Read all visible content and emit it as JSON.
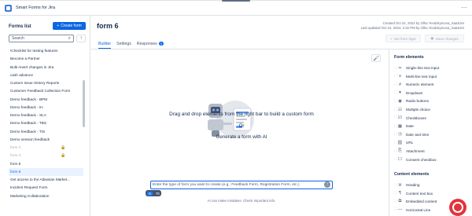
{
  "app": {
    "title": "Smart Forms for Jira"
  },
  "sidebar": {
    "title": "Forms list",
    "create_label": "Create form",
    "search_placeholder": "Search",
    "items": [
      {
        "label": "!Checklist for testing features"
      },
      {
        "label": "Become a Partner"
      },
      {
        "label": "Bulk revert changes in Jira"
      },
      {
        "label": "cash advance"
      },
      {
        "label": "Custom Issue History Reports"
      },
      {
        "label": "Customer Feedback Collection Form"
      },
      {
        "label": "Demo feedback - BPM"
      },
      {
        "label": "Demo feedback - IH"
      },
      {
        "label": "Demo feedback - SLA"
      },
      {
        "label": "Demo feedback - TBS"
      },
      {
        "label": "Demo feedback - TIS"
      },
      {
        "label": "Demo session feedback"
      },
      {
        "label": "form 3",
        "locked": true
      },
      {
        "label": "form 4",
        "locked": true
      },
      {
        "label": "form 5"
      },
      {
        "label": "form 6",
        "selected": true
      },
      {
        "label": "Get access to the Atlassian Market..."
      },
      {
        "label": "Incident Request Form"
      },
      {
        "label": "Marketing Collaboration"
      }
    ]
  },
  "form": {
    "title": "form 6",
    "created": "Created Oct 24, 2024 by Olha Yevdokymova_SaaSJet",
    "updated": "Last updated Oct 24, 2024, 2:32 PM by Olha Yevdokymova_SaaSJet",
    "set_logic_label": "Set form logic",
    "save_label": "Save changes"
  },
  "tabs": [
    {
      "label": "Builder",
      "active": true
    },
    {
      "label": "Settings"
    },
    {
      "label": "Responses",
      "badge": "0"
    }
  ],
  "builder": {
    "dropzone_text": "Drag and drop elements from the right bar to build a custom form",
    "or_text": "Or",
    "generate_text": "Generate a form with AI",
    "ai_placeholder": "Enter the type of form you want to create (e.g., Feedback Form, Registration Form, etc.)",
    "chip_a": "A",
    "chip_count": "78",
    "disclaimer": "AI can make mistakes. Check important info."
  },
  "elements_panel": {
    "form_elements_title": "Form elements",
    "form_elements": [
      {
        "label": "Single-line text input",
        "icon": "text-line-icon"
      },
      {
        "label": "Multi-line text input",
        "icon": "text-multiline-icon"
      },
      {
        "label": "Numeric element",
        "icon": "numeric-icon"
      },
      {
        "label": "Dropdown",
        "icon": "dropdown-icon"
      },
      {
        "label": "Radio buttons",
        "icon": "radio-icon"
      },
      {
        "label": "Multiple choice",
        "icon": "multiple-choice-icon"
      },
      {
        "label": "Checkboxes",
        "icon": "checkbox-icon"
      },
      {
        "label": "Date",
        "icon": "calendar-icon"
      },
      {
        "label": "Date and time",
        "icon": "calendar-clock-icon"
      },
      {
        "label": "URL",
        "icon": "link-icon"
      },
      {
        "label": "Attachment",
        "icon": "attachment-icon"
      },
      {
        "label": "Consent checkbox",
        "icon": "consent-checkbox-icon"
      }
    ],
    "content_elements_title": "Content elements",
    "content_elements": [
      {
        "label": "Heading",
        "icon": "heading-icon"
      },
      {
        "label": "Content text box",
        "icon": "text-box-icon"
      },
      {
        "label": "Embedded content",
        "icon": "embed-icon"
      },
      {
        "label": "Horizontal Line",
        "icon": "horizontal-line-icon"
      }
    ]
  }
}
